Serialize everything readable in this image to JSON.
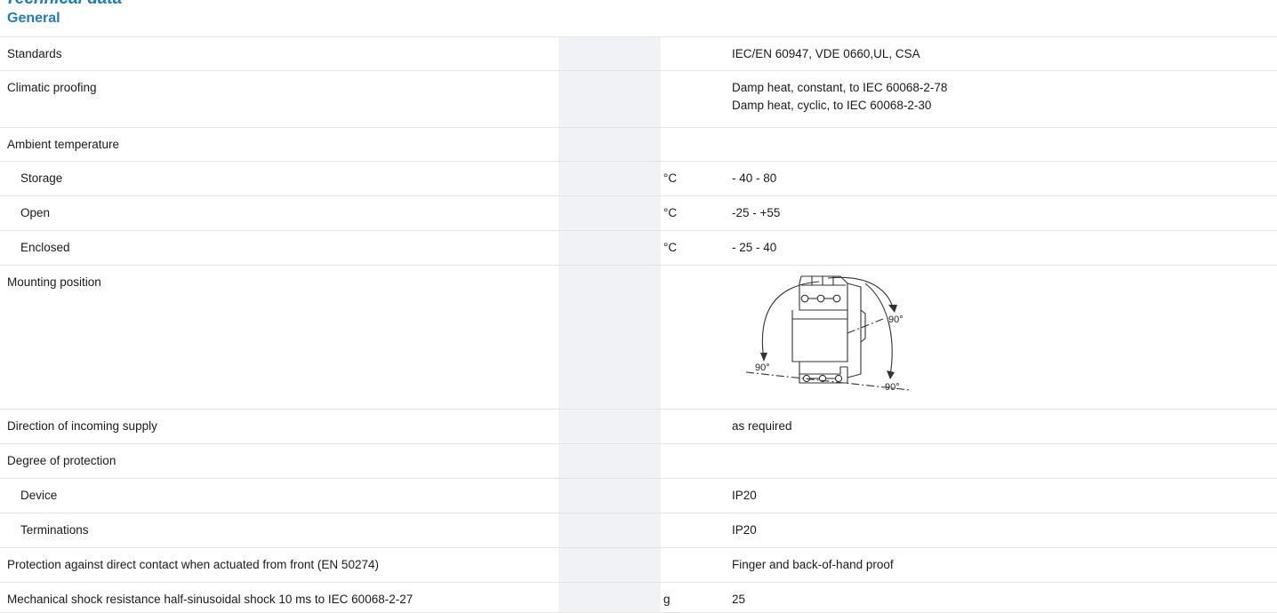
{
  "page_heading": "Technical data",
  "section_title": "General",
  "rows": [
    {
      "label": "Standards",
      "unit": "",
      "value": [
        "IEC/EN 60947, VDE 0660,UL, CSA"
      ]
    },
    {
      "label": "Climatic proofing",
      "unit": "",
      "value": [
        "Damp heat, constant, to IEC 60068-2-78",
        "Damp heat, cyclic, to IEC 60068-2-30"
      ]
    },
    {
      "label": "Ambient temperature",
      "unit": "",
      "value": []
    },
    {
      "label": "Storage",
      "unit": "°C",
      "value": [
        "- 40 - 80"
      ]
    },
    {
      "label": "Open",
      "unit": "°C",
      "value": [
        "-25 - +55"
      ]
    },
    {
      "label": "Enclosed",
      "unit": "°C",
      "value": [
        "- 25 - 40"
      ]
    },
    {
      "label": "Mounting position",
      "unit": "",
      "value": [],
      "figure_labels": {
        "right_top": "90°",
        "left": "90°",
        "right_bottom": "90°"
      }
    },
    {
      "label": "Direction of incoming supply",
      "unit": "",
      "value": [
        "as required"
      ]
    },
    {
      "label": "Degree of protection",
      "unit": "",
      "value": []
    },
    {
      "label": "Device",
      "unit": "",
      "value": [
        "IP20"
      ]
    },
    {
      "label": "Terminations",
      "unit": "",
      "value": [
        "IP20"
      ]
    },
    {
      "label": "Protection against direct contact when actuated from front (EN 50274)",
      "unit": "",
      "value": [
        "Finger and back-of-hand proof"
      ]
    },
    {
      "label": "Mechanical shock resistance half-sinusoidal shock 10 ms to IEC 60068-2-27",
      "unit": "g",
      "value": [
        "25"
      ]
    }
  ],
  "colors": {
    "heading": "#1f7cc1",
    "shaded_column": "#f1f2f5",
    "rule": "#e4e4e4",
    "text": "#1a1a1a"
  }
}
